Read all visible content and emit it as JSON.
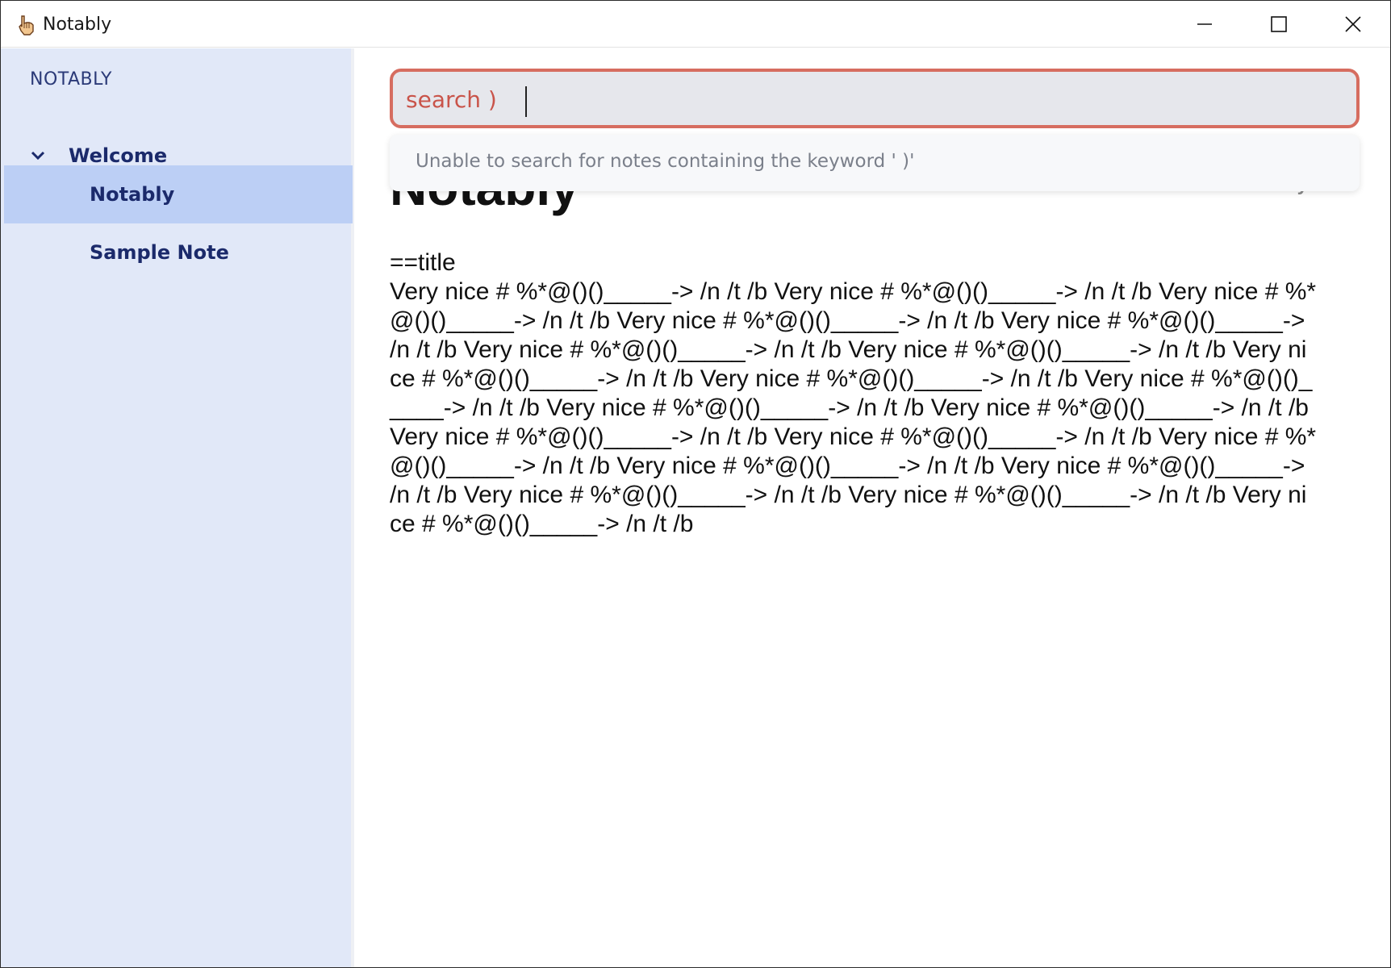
{
  "window": {
    "title": "Notably",
    "icon": "hand-pointer-icon"
  },
  "sidebar": {
    "header": "NOTABLY",
    "items": [
      {
        "label": "Welcome",
        "expanded": true
      },
      {
        "label": "Notably",
        "selected": true
      },
      {
        "label": "Sample Note"
      }
    ]
  },
  "search": {
    "value": "search )",
    "message": "Unable to search for notes containing the keyword ' )'"
  },
  "note": {
    "title": "Notably",
    "breadcrumb": "/ Welcome / Notably",
    "body": "==title\nVery nice # %*@()()_____-> /n /t /b Very nice # %*@()()_____-> /n /t /b Very nice # %*@()()_____-> /n /t /b Very nice # %*@()()_____-> /n /t /b Very nice # %*@()()_____-> /n /t /b Very nice # %*@()()_____-> /n /t /b Very nice # %*@()()_____-> /n /t /b Very nice # %*@()()_____-> /n /t /b Very nice # %*@()()_____-> /n /t /b Very nice # %*@()()_____-> /n /t /b Very nice # %*@()()_____-> /n /t /b Very nice # %*@()()_____-> /n /t /b Very nice # %*@()()_____-> /n /t /b Very nice # %*@()()_____-> /n /t /b Very nice # %*@()()_____-> /n /t /b Very nice # %*@()()_____-> /n /t /b Very nice # %*@()()_____-> /n /t /b Very nice # %*@()()_____-> /n /t /b Very nice # %*@()()_____-> /n /t /b Very nice # %*@()()_____-> /n /t /b"
  },
  "colors": {
    "sidebar_bg": "#e1e8f8",
    "selected_bg": "#bccff5",
    "search_border": "#d66d60",
    "search_text": "#c9544a"
  }
}
